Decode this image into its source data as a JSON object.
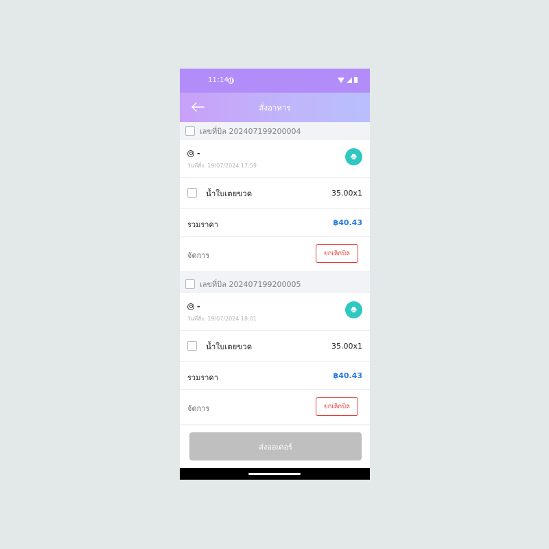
{
  "status_bar": {
    "time": "11:14"
  },
  "header": {
    "title": "สั่งอาหาร"
  },
  "bills": [
    {
      "bill_label": "เลขที่บิล 202407199200004",
      "user_name": "-",
      "order_date": "วันที่สั่ง: 19/07/2024 17:59",
      "item_name": "น้ำใบเตยขวด",
      "item_qty": "35.00x1",
      "total_label": "รวมราคา",
      "total_value": "฿40.43",
      "manage_label": "จัดการ",
      "cancel_label": "ยกเลิกบิล"
    },
    {
      "bill_label": "เลขที่บิล 202407199200005",
      "user_name": "-",
      "order_date": "วันที่สั่ง: 19/07/2024 18:01",
      "item_name": "น้ำใบเตยขวด",
      "item_qty": "35.00x1",
      "total_label": "รวมราคา",
      "total_value": "฿40.43",
      "manage_label": "จัดการ",
      "cancel_label": "ยกเลิกบิล"
    }
  ],
  "footer": {
    "submit_label": "ส่งออเดอร์"
  },
  "colors": {
    "header_start": "#c8a0f8",
    "header_end": "#b9bffc",
    "accent_teal": "#2fc7c1",
    "price_blue": "#2d7ae0",
    "cancel_red": "#e53935",
    "disabled_gray": "#bfbfbf"
  },
  "icons": {
    "back": "arrow-left-icon",
    "print": "printer-icon",
    "user": "user-icon"
  }
}
